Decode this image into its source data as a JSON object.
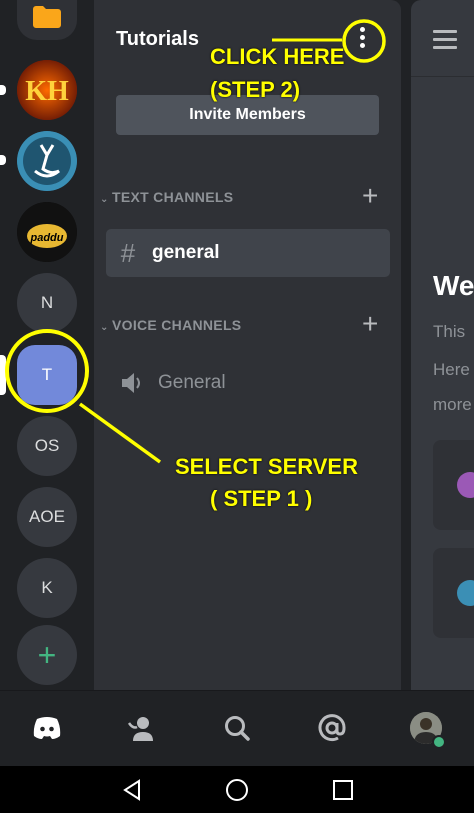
{
  "rail": {
    "servers": [
      {
        "id": "kh",
        "label": "KH"
      },
      {
        "id": "deer",
        "label": ""
      },
      {
        "id": "paddu",
        "label": "paddu"
      },
      {
        "id": "n",
        "label": "N"
      },
      {
        "id": "t",
        "label": "T"
      },
      {
        "id": "os",
        "label": "OS"
      },
      {
        "id": "aoe",
        "label": "AOE"
      },
      {
        "id": "k",
        "label": "K"
      }
    ],
    "add_label": "+"
  },
  "guild": {
    "name": "Tutorials",
    "invite_label": "Invite Members"
  },
  "categories": {
    "text": {
      "label": "TEXT CHANNELS",
      "channels": [
        {
          "name": "general"
        }
      ]
    },
    "voice": {
      "label": "VOICE CHANNELS",
      "channels": [
        {
          "name": "General"
        }
      ]
    }
  },
  "chat": {
    "welcome_title": "We",
    "lines": [
      "This",
      "Here",
      "more"
    ]
  },
  "annotations": {
    "step2_line1": "CLICK HERE",
    "step2_line2": "(STEP 2)",
    "step1_line1": "SELECT SERVER",
    "step1_line2": "( STEP 1 )",
    "color": "#ffff00"
  },
  "colors": {
    "accent": "#7289da",
    "online": "#43b581",
    "add": "#43b581"
  },
  "icons": {
    "folder": "folder-icon",
    "hash": "hash-icon",
    "speaker": "speaker-icon",
    "menu": "hamburger-menu-icon",
    "home": "discord-home-icon",
    "friends": "friends-icon",
    "search": "search-icon",
    "mentions": "at-mention-icon",
    "back": "android-back-icon",
    "home_android": "android-home-icon",
    "recents": "android-recents-icon"
  }
}
